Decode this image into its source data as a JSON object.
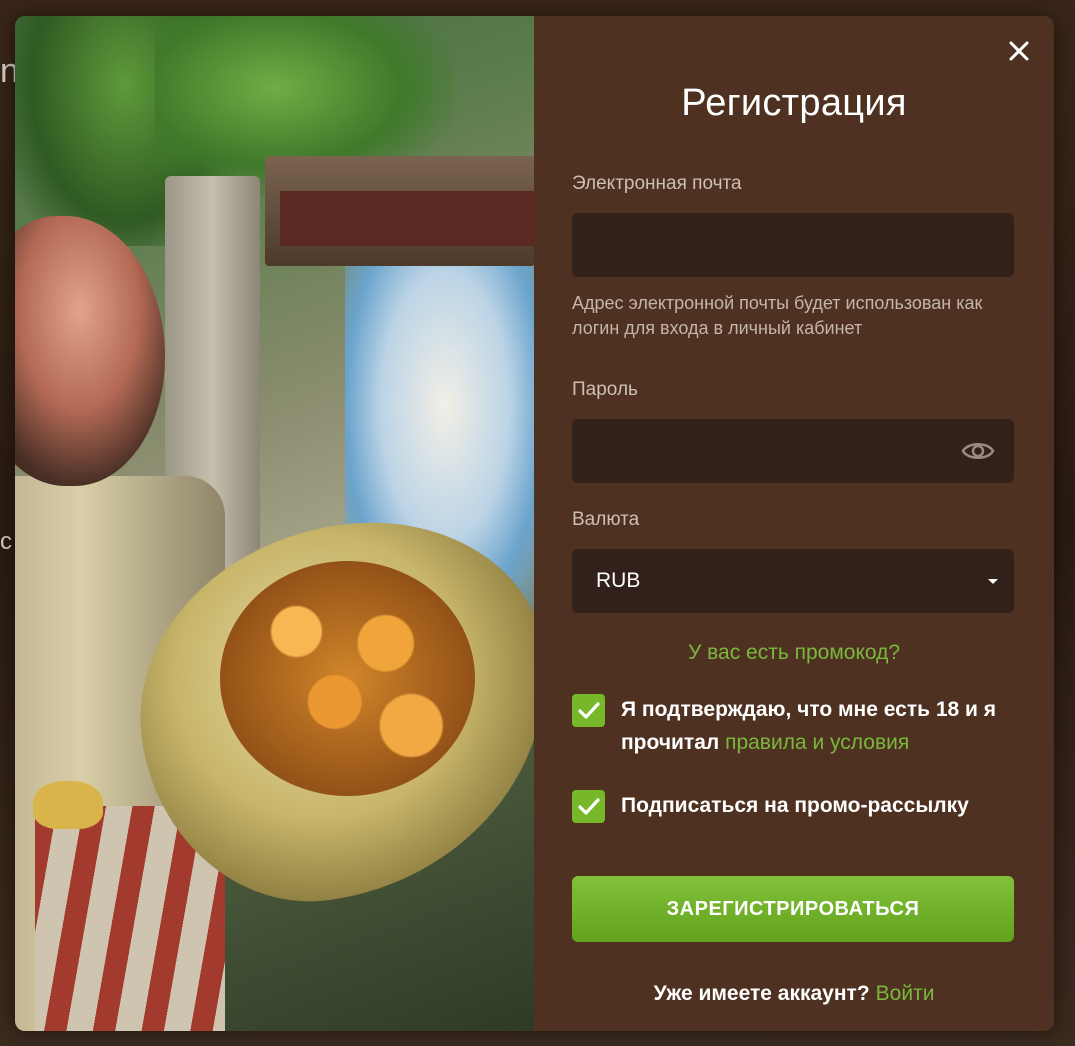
{
  "background": {
    "fragment_letter_1": "n",
    "fragment_letter_2": "c"
  },
  "modal": {
    "title": "Регистрация",
    "close_icon": "close-icon",
    "email": {
      "label": "Электронная почта",
      "value": "",
      "placeholder": "",
      "hint": "Адрес электронной почты будет использован как логин для входа в личный кабинет"
    },
    "password": {
      "label": "Пароль",
      "value": "",
      "placeholder": "",
      "toggle_icon": "eye-icon"
    },
    "currency": {
      "label": "Валюта",
      "selected": "RUB"
    },
    "promo_link": "У вас есть промокод?",
    "terms_checkbox": {
      "checked": true,
      "text": "Я подтверждаю, что мне есть 18 и я прочитал",
      "link": "правила и условия"
    },
    "newsletter_checkbox": {
      "checked": true,
      "text": "Подписаться на промо-рассылку"
    },
    "submit_label": "ЗАРЕГИСТРИРОВАТЬСЯ",
    "footer": {
      "text": "Уже имеете аккаунт?",
      "login_link": "Войти"
    }
  },
  "colors": {
    "accent": "#7ab83d",
    "panel": "#4e3120",
    "field": "#32201a"
  }
}
